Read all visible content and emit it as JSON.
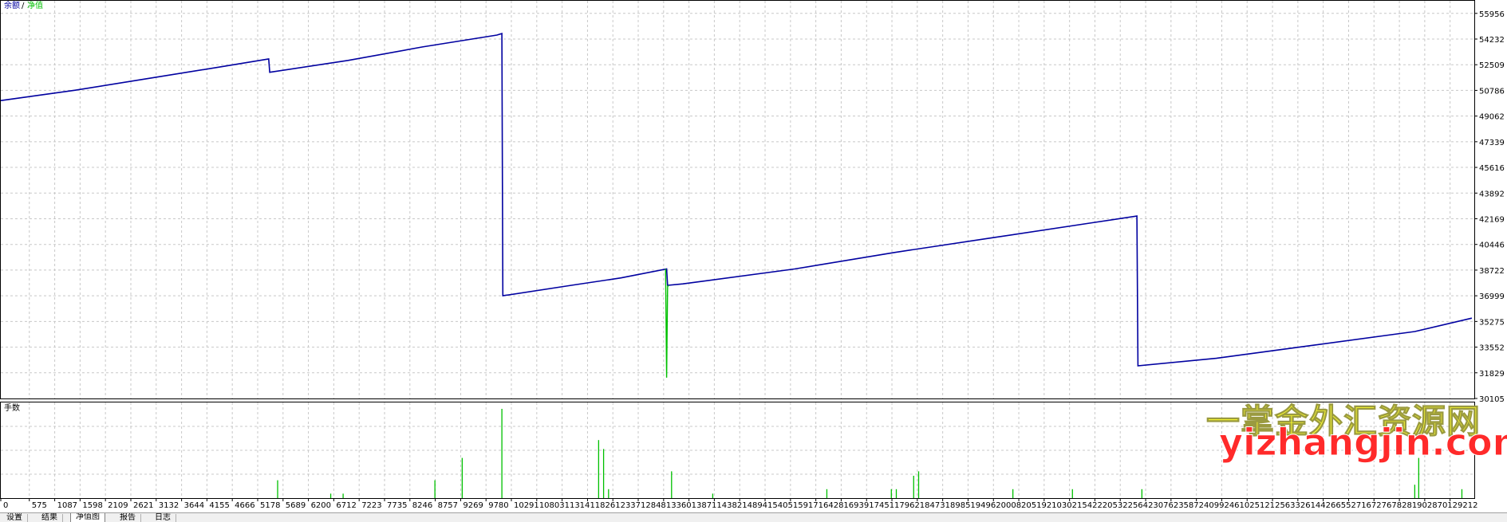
{
  "window": {
    "legend_balance": "余额",
    "legend_sep": " / ",
    "legend_equity": "净值",
    "lots_panel_title": "手数"
  },
  "watermark": {
    "line1": "一掌金外汇资源网",
    "line2": "yizhangjin.com"
  },
  "tabs": [
    {
      "label": "设置",
      "active": false
    },
    {
      "label": "结果",
      "active": false
    },
    {
      "label": "净值图",
      "active": true
    },
    {
      "label": "报告",
      "active": false
    },
    {
      "label": "日志",
      "active": false
    }
  ],
  "colors": {
    "balance": "#0000a0",
    "equity": "#00c000",
    "lots": "#00c000",
    "grid": "#c8c8c8",
    "background": "#ffffff"
  },
  "chart_data": [
    {
      "type": "line",
      "title": "",
      "ylabel": "",
      "xlabel": "",
      "grid": true,
      "ylim": [
        30105,
        56800
      ],
      "xlim": [
        0,
        29700
      ],
      "y_ticks": [
        55956,
        54232,
        52509,
        50786,
        49062,
        47339,
        45616,
        43892,
        42169,
        40446,
        38722,
        36999,
        35275,
        33552,
        31829,
        30105
      ],
      "x_ticks": [
        0,
        575,
        1087,
        1598,
        2109,
        2621,
        3132,
        3644,
        4155,
        4666,
        5178,
        5689,
        6200,
        6712,
        7223,
        7735,
        8246,
        8757,
        9269,
        9780,
        10291,
        10803,
        11314,
        11826,
        12337,
        12848,
        13360,
        13871,
        14382,
        14894,
        15405,
        15917,
        16428,
        16939,
        17451,
        17962,
        18473,
        18985,
        19496,
        20008,
        20519,
        21030,
        21542,
        22053,
        22564,
        23076,
        23587,
        24099,
        24610,
        25121,
        25633,
        26144,
        26655,
        27167,
        27678,
        28190,
        28701,
        29212
      ],
      "series": [
        {
          "name": "余额",
          "color": "#0000a0",
          "x": [
            0,
            1500,
            3000,
            4500,
            5400,
            5420,
            7000,
            8500,
            10000,
            10100,
            10120,
            11500,
            12500,
            13420,
            13440,
            13750,
            16000,
            18000,
            20000,
            22000,
            22900,
            22920,
            24500,
            26500,
            28500,
            29650
          ],
          "y": [
            50100,
            50800,
            51600,
            52400,
            52900,
            52000,
            52800,
            53700,
            54500,
            54600,
            37000,
            37700,
            38200,
            38800,
            37700,
            37800,
            38800,
            39900,
            40900,
            41900,
            42350,
            32300,
            32800,
            33700,
            34600,
            35500
          ]
        },
        {
          "name": "净值",
          "color": "#00c000",
          "x": [
            13400,
            13420,
            13440,
            13460
          ],
          "y": [
            38800,
            31500,
            37600,
            37700
          ]
        }
      ]
    },
    {
      "type": "bar",
      "title": "手数",
      "series": [
        {
          "name": "手数",
          "x": [
            5580,
            6650,
            6900,
            8750,
            9300,
            10100,
            12050,
            12150,
            12250,
            13520,
            14350,
            16650,
            17950,
            18050,
            18400,
            18500,
            20400,
            21600,
            23000,
            28500,
            28580,
            29450
          ],
          "values": [
            0.2,
            0.05,
            0.05,
            0.2,
            0.45,
            1.0,
            0.65,
            0.55,
            0.1,
            0.3,
            0.05,
            0.1,
            0.1,
            0.1,
            0.25,
            0.3,
            0.1,
            0.1,
            0.1,
            0.15,
            0.45,
            0.1
          ]
        }
      ]
    }
  ]
}
